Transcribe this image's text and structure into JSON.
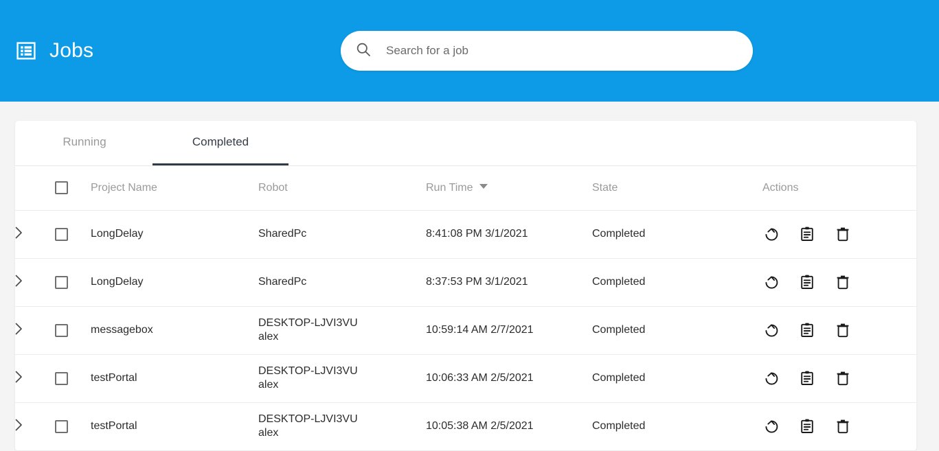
{
  "header": {
    "title": "Jobs",
    "icon": "list-table-icon",
    "background_color": "#0d9be7"
  },
  "search": {
    "placeholder": "Search for a job",
    "value": "",
    "icon": "search-icon"
  },
  "tabs": [
    {
      "label": "Running",
      "active": false
    },
    {
      "label": "Completed",
      "active": true
    }
  ],
  "table": {
    "columns": [
      {
        "key": "expand",
        "label": ""
      },
      {
        "key": "select",
        "label": ""
      },
      {
        "key": "project",
        "label": "Project Name"
      },
      {
        "key": "robot",
        "label": "Robot"
      },
      {
        "key": "runtime",
        "label": "Run Time",
        "sorted": "desc",
        "sort_icon": "caret-down-icon"
      },
      {
        "key": "state",
        "label": "State"
      },
      {
        "key": "actions",
        "label": "Actions"
      }
    ],
    "select_all_checked": false,
    "action_icons": [
      "restart-icon",
      "clipboard-log-icon",
      "trash-delete-icon"
    ],
    "rows": [
      {
        "project": "LongDelay",
        "robot": "SharedPc",
        "runtime": "8:41:08 PM 3/1/2021",
        "state": "Completed",
        "checked": false,
        "expanded": false
      },
      {
        "project": "LongDelay",
        "robot": "SharedPc",
        "runtime": "8:37:53 PM 3/1/2021",
        "state": "Completed",
        "checked": false,
        "expanded": false
      },
      {
        "project": "messagebox",
        "robot": "DESKTOP-LJVI3VU alex",
        "runtime": "10:59:14 AM 2/7/2021",
        "state": "Completed",
        "checked": false,
        "expanded": false
      },
      {
        "project": "testPortal",
        "robot": "DESKTOP-LJVI3VU alex",
        "runtime": "10:06:33 AM 2/5/2021",
        "state": "Completed",
        "checked": false,
        "expanded": false
      },
      {
        "project": "testPortal",
        "robot": "DESKTOP-LJVI3VU alex",
        "runtime": "10:05:38 AM 2/5/2021",
        "state": "Completed",
        "checked": false,
        "expanded": false
      }
    ]
  }
}
